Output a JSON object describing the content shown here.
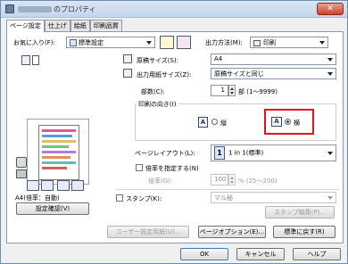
{
  "window": {
    "title": "のプロパティ",
    "close_glyph": "✕"
  },
  "tabs": [
    "ページ設定",
    "仕上げ",
    "給紙",
    "印刷品質"
  ],
  "favorites": {
    "label": "お気に入り(F):",
    "value": "標準設定"
  },
  "output_method": {
    "label": "出力方法(M):",
    "value": "印刷"
  },
  "page_size": {
    "label": "原稿サイズ(S):",
    "value": "A4"
  },
  "output_size": {
    "label": "出力用紙サイズ(Z):",
    "value": "原稿サイズと同じ"
  },
  "copies": {
    "label": "部数(C):",
    "value": "1",
    "range": "部 (1～9999)"
  },
  "orientation": {
    "label": "印刷の向き(I)",
    "portrait_glyph": "A",
    "portrait_label": "縦",
    "landscape_glyph": "A",
    "landscape_label": "横",
    "selected": "landscape"
  },
  "page_layout": {
    "label": "ページレイアウト(L):",
    "value": "1 in 1(標準)",
    "icon_text": "1"
  },
  "scaling": {
    "checkbox_label": "倍率を指定する(N)",
    "value_label": "倍率(G):",
    "value": "100",
    "range": "% (25～200)"
  },
  "stamp": {
    "checkbox_label": "スタンプ(K):",
    "value": "マル秘",
    "edit_button": "スタンプ編集(P)..."
  },
  "preview": {
    "caption": "A4(倍率：自動)",
    "settings_button": "設定確認(V)"
  },
  "bottom_buttons": {
    "user_settings": "ユーザー設定用紙(U)...",
    "page_options": "ページオプション(E)...",
    "restore_defaults": "標準に戻す(R)"
  },
  "dialog_buttons": {
    "ok": "OK",
    "cancel": "キャンセル",
    "help": "ヘルプ"
  }
}
